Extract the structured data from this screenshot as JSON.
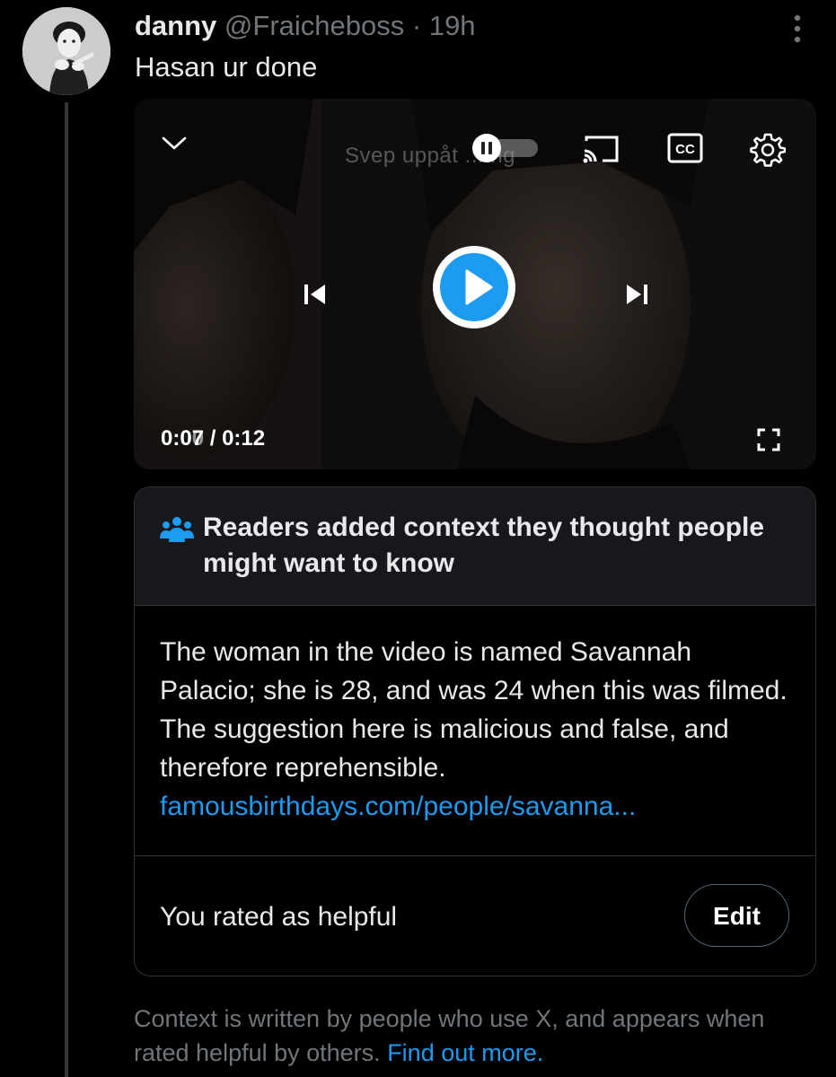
{
  "tweet": {
    "display_name": "danny",
    "handle": "@Fraicheboss",
    "separator": "·",
    "time": "19h",
    "text": "Hasan ur done",
    "avatar_icon": "user-avatar-photo",
    "more_icon": "more-vertical-icon"
  },
  "video": {
    "overlay_text": "Svep uppåt ... ng",
    "current_time": "0:07",
    "ghost_time": "0:00",
    "total_separator": " / ",
    "total_time": "0:12",
    "icons": {
      "collapse": "chevron-down-icon",
      "pause_toggle": "pause-toggle-icon",
      "cast": "cast-icon",
      "captions": "cc-icon",
      "settings": "gear-icon",
      "previous": "skip-previous-icon",
      "play": "play-icon",
      "next": "skip-next-icon",
      "fullscreen": "fullscreen-icon"
    },
    "accent_color": "#1d9bf0"
  },
  "community_note": {
    "title": "Readers added context they thought people might want to know",
    "body": "The woman in the video is named Savannah Palacio; she is 28, and was 24 when this was filmed. The suggestion here is malicious and false, and therefore reprehensible.",
    "link": "famousbirthdays.com/people/savanna...",
    "rating_status": "You rated as helpful",
    "edit_label": "Edit",
    "icon": "people-icon"
  },
  "footer": {
    "text": "Context is written by people who use X, and appears when rated helpful by others.",
    "link": "Find out more."
  },
  "colors": {
    "background": "#000000",
    "text": "#e7e9ea",
    "muted": "#71767b",
    "link": "#1d9bf0",
    "border": "#2f3336"
  }
}
